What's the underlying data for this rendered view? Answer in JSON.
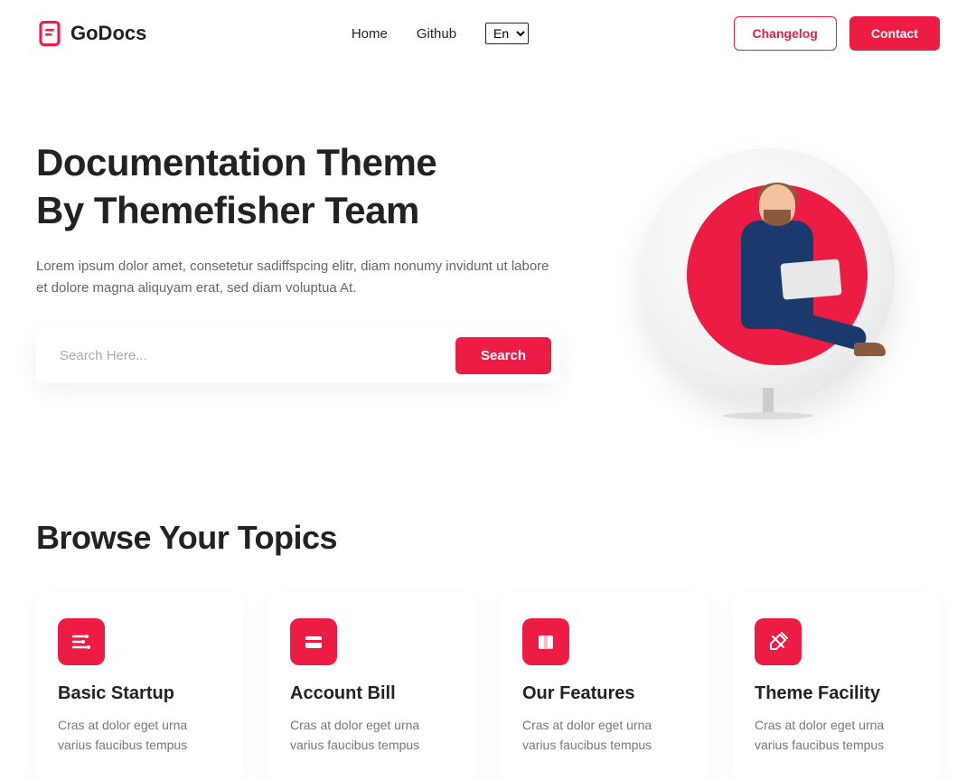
{
  "brand": {
    "name": "GoDocs"
  },
  "nav": {
    "home": "Home",
    "github": "Github",
    "lang_selected": "En"
  },
  "header_actions": {
    "changelog": "Changelog",
    "contact": "Contact"
  },
  "hero": {
    "title_line1": "Documentation Theme",
    "title_line2": "By Themefisher Team",
    "description": "Lorem ipsum dolor amet, consetetur sadiffspcing elitr, diam nonumy invidunt ut labore et dolore magna aliquyam erat, sed diam voluptua At.",
    "search_placeholder": "Search Here...",
    "search_button": "Search"
  },
  "topics": {
    "heading": "Browse Your Topics",
    "cards": [
      {
        "title": "Basic Startup",
        "desc": "Cras at dolor eget urna varius faucibus tempus"
      },
      {
        "title": "Account Bill",
        "desc": "Cras at dolor eget urna varius faucibus tempus"
      },
      {
        "title": "Our Features",
        "desc": "Cras at dolor eget urna varius faucibus tempus"
      },
      {
        "title": "Theme Facility",
        "desc": "Cras at dolor eget urna varius faucibus tempus"
      }
    ]
  },
  "colors": {
    "accent": "#ED1C45"
  }
}
